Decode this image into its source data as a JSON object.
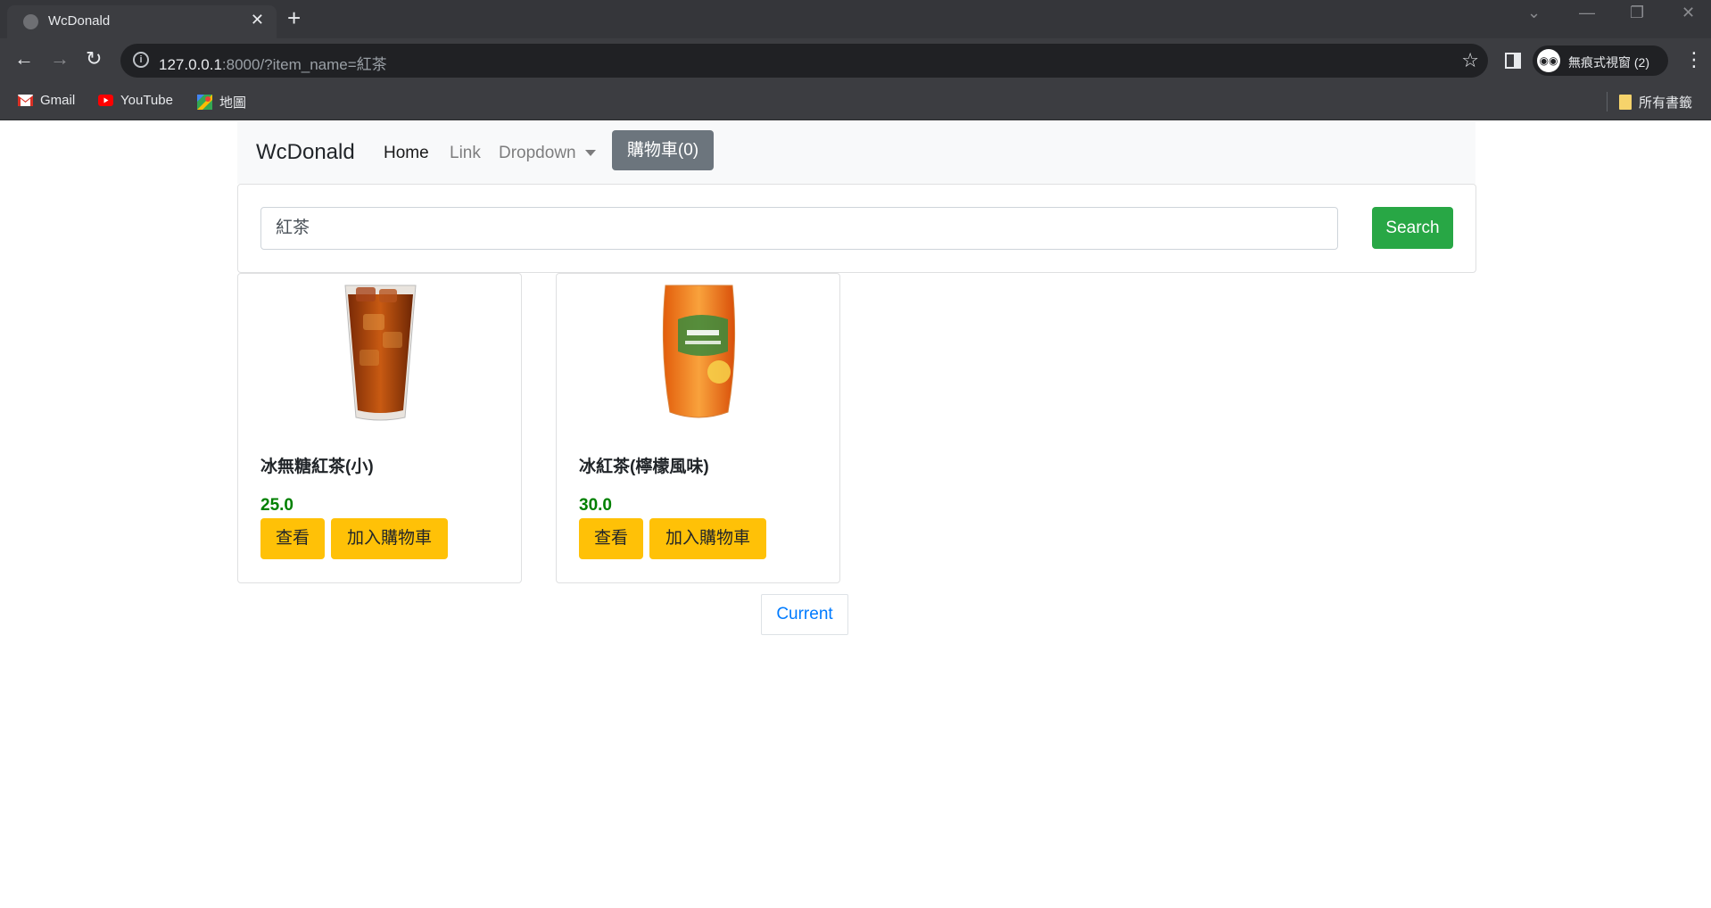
{
  "browser": {
    "tab_title": "WcDonald",
    "tab_close": "✕",
    "new_tab": "+",
    "url_host": "127.0.0.1",
    "url_rest": ":8000/?item_name=紅茶",
    "incognito_label": "無痕式視窗 (2)",
    "bookmarks": [
      "Gmail",
      "YouTube",
      "地圖"
    ],
    "all_bookmarks": "所有書籤"
  },
  "navbar": {
    "brand": "WcDonald",
    "links": [
      "Home",
      "Link",
      "Dropdown"
    ],
    "cart_label": "購物車(0)"
  },
  "search": {
    "value": "紅茶",
    "button_label": "Search"
  },
  "products": [
    {
      "name": "冰無糖紅茶(小)",
      "price": "25.0",
      "view_label": "查看",
      "add_label": "加入購物車"
    },
    {
      "name": "冰紅茶(檸檬風味)",
      "price": "30.0",
      "view_label": "查看",
      "add_label": "加入購物車"
    }
  ],
  "pagination": {
    "current_label": "Current"
  },
  "colors": {
    "accent_green": "#28a745",
    "accent_yellow": "#ffc107",
    "price_green": "#008000",
    "cart_gray": "#6c757d",
    "link_blue": "#007bff"
  },
  "icons": [
    "globe-icon",
    "close-icon",
    "plus-icon",
    "back-arrow-icon",
    "forward-arrow-icon",
    "reload-icon",
    "info-icon",
    "star-icon",
    "side-panel-icon",
    "incognito-icon",
    "more-vert-icon",
    "gmail-icon",
    "youtube-icon",
    "maps-icon",
    "folder-icon"
  ]
}
